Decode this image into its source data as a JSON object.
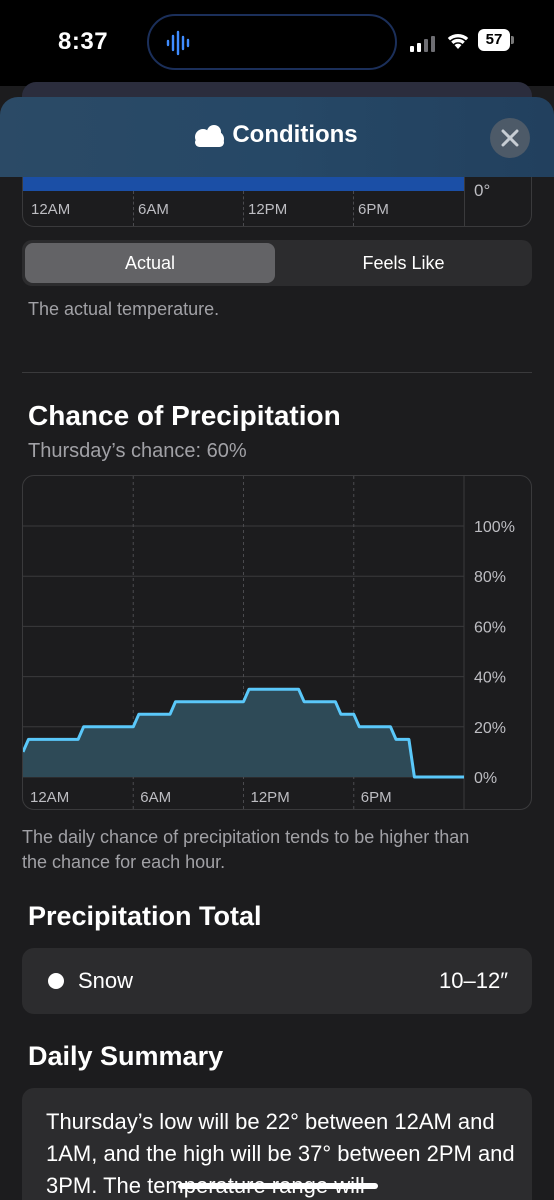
{
  "status_bar": {
    "time": "8:37",
    "battery": "57"
  },
  "header": {
    "title": "Conditions",
    "icon": "cloud-icon",
    "close_icon": "close-icon"
  },
  "temperature_chart": {
    "x_ticks": [
      "12AM",
      "6AM",
      "12PM",
      "6PM"
    ],
    "y_tick_visible": "0°"
  },
  "segmented": {
    "options": [
      "Actual",
      "Feels Like"
    ],
    "selected": "Actual"
  },
  "temperature_caption": "The actual temperature.",
  "precipitation": {
    "title": "Chance of Precipitation",
    "subtitle": "Thursday’s chance: 60%",
    "caption_line1": "The daily chance of precipitation tends to be higher than",
    "caption_line2": "the chance for each hour."
  },
  "chart_data": {
    "type": "area",
    "x": [
      "12AM",
      "1AM",
      "2AM",
      "3AM",
      "4AM",
      "5AM",
      "6AM",
      "7AM",
      "8AM",
      "9AM",
      "10AM",
      "11AM",
      "12PM",
      "1PM",
      "2PM",
      "3PM",
      "4PM",
      "5PM",
      "6PM",
      "7PM",
      "8PM",
      "9PM",
      "10PM",
      "11PM"
    ],
    "x_tick_labels": [
      "12AM",
      "6AM",
      "12PM",
      "6PM"
    ],
    "y_tick_labels": [
      "100%",
      "80%",
      "60%",
      "40%",
      "20%",
      "0%"
    ],
    "series": [
      {
        "values": [
          10,
          15,
          15,
          15,
          20,
          20,
          20,
          25,
          25,
          30,
          30,
          30,
          30,
          35,
          35,
          35,
          30,
          30,
          25,
          20,
          20,
          15,
          0,
          0,
          0
        ]
      }
    ],
    "ylim": [
      0,
      100
    ],
    "grid": true,
    "line_color": "#5ac8fa",
    "fill_color": "#2e4a57"
  },
  "precipitation_total": {
    "title": "Precipitation Total",
    "type_label": "Snow",
    "amount": "10–12″"
  },
  "daily_summary": {
    "title": "Daily Summary",
    "text": "Thursday’s low will be 22° between 12AM and 1AM, and the high will be 37° between 2PM and 3PM. The temperature range will"
  }
}
